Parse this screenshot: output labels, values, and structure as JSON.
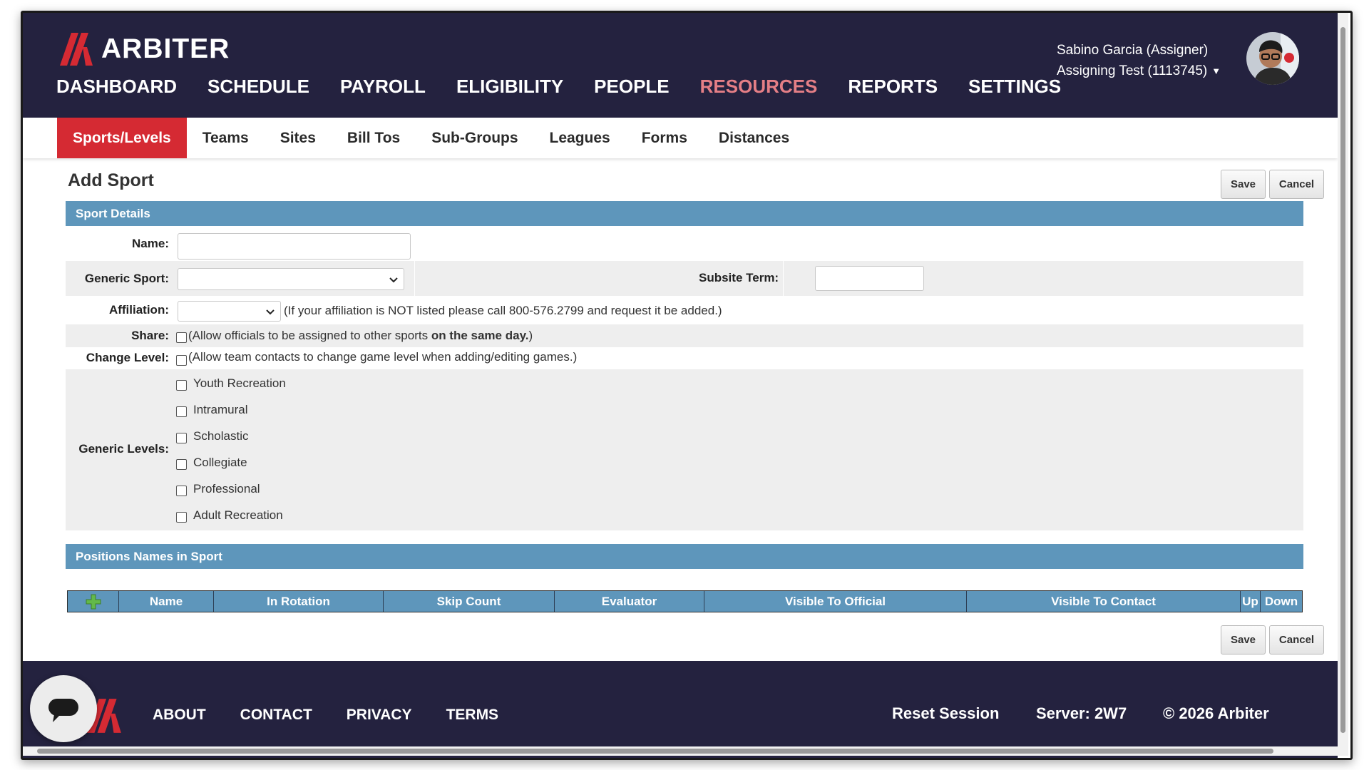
{
  "brand": {
    "name": "ARBITER",
    "accent": "#d52a33",
    "header_bg": "#24223f",
    "section_bg": "#5e96bb"
  },
  "main_nav": [
    {
      "label": "DASHBOARD"
    },
    {
      "label": "SCHEDULE"
    },
    {
      "label": "PAYROLL"
    },
    {
      "label": "ELIGIBILITY"
    },
    {
      "label": "PEOPLE"
    },
    {
      "label": "RESOURCES",
      "active": true
    },
    {
      "label": "REPORTS"
    },
    {
      "label": "SETTINGS"
    }
  ],
  "user": {
    "name": "Sabino Garcia (Assigner)",
    "account": "Assigning Test (1113745)",
    "menu_icon": "caret-down-icon"
  },
  "sub_nav": [
    {
      "label": "Sports/Levels",
      "active": true
    },
    {
      "label": "Teams"
    },
    {
      "label": "Sites"
    },
    {
      "label": "Bill Tos"
    },
    {
      "label": "Sub-Groups"
    },
    {
      "label": "Leagues"
    },
    {
      "label": "Forms"
    },
    {
      "label": "Distances"
    }
  ],
  "page": {
    "title": "Add Sport",
    "save_label": "Save",
    "cancel_label": "Cancel"
  },
  "sport_details": {
    "header": "Sport Details",
    "name_label": "Name:",
    "name_value": "",
    "generic_sport_label": "Generic Sport:",
    "generic_sport_value": "",
    "subsite_term_label": "Subsite Term:",
    "subsite_term_value": "",
    "affiliation_label": "Affiliation:",
    "affiliation_value": "",
    "affiliation_note": "(If your affiliation is NOT listed please call 800-576.2799 and request it be added.)",
    "share_label": "Share:",
    "share_text_pre": "(Allow officials to be assigned to other sports ",
    "share_text_bold": "on the same day.",
    "share_text_post": ")",
    "change_level_label": "Change Level:",
    "change_level_text": "(Allow team contacts to change game level when adding/editing games.)",
    "generic_levels_label": "Generic Levels:",
    "levels": [
      "Youth Recreation",
      "Intramural",
      "Scholastic",
      "Collegiate",
      "Professional",
      "Adult Recreation"
    ]
  },
  "positions": {
    "header": "Positions Names in Sport",
    "add_icon": "plus-icon",
    "columns": [
      "Name",
      "In Rotation",
      "Skip Count",
      "Evaluator",
      "Visible To Official",
      "Visible To Contact",
      "Up",
      "Down"
    ]
  },
  "footer": {
    "links": [
      "ABOUT",
      "CONTACT",
      "PRIVACY",
      "TERMS"
    ],
    "reset_session": "Reset Session",
    "server": "Server: 2W7",
    "copyright": "© 2026 Arbiter",
    "chat_icon": "chat-bubble-icon"
  }
}
